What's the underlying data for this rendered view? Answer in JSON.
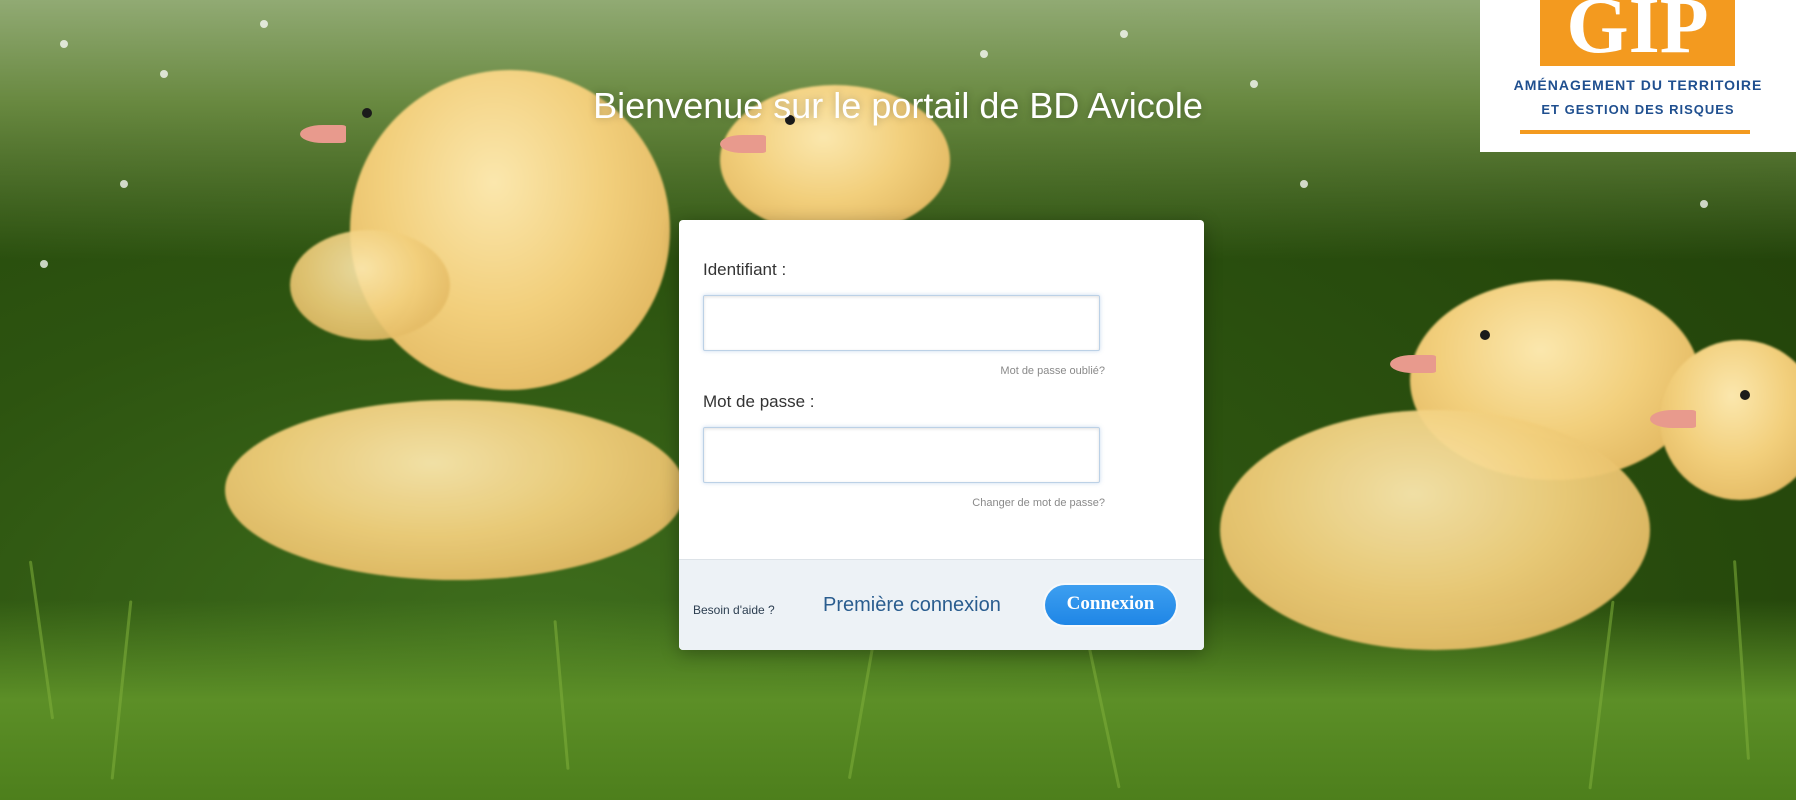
{
  "header": {
    "welcome": "Bienvenue sur le portail de BD Avicole"
  },
  "logo": {
    "acronym": "GIP",
    "line1": "AMÉNAGEMENT DU TERRITOIRE",
    "line2": "ET GESTION DES RISQUES",
    "accent_color": "#f39a1f",
    "text_color": "#1f4f8f"
  },
  "login": {
    "identifiant_label": "Identifiant :",
    "identifiant_value": "",
    "forgot_password_link": "Mot de passe oublié?",
    "password_label": "Mot de passe :",
    "password_value": "",
    "change_password_link": "Changer de mot de passe?",
    "help_text": "Besoin d'aide ?",
    "first_connection_link": "Première connexion",
    "connect_button": "Connexion",
    "button_color": "#1f86e6"
  }
}
